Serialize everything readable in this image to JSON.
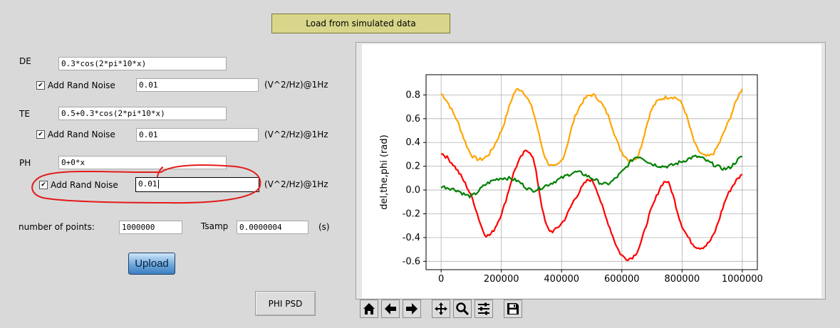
{
  "load_button": "Load from simulated data",
  "de": {
    "label": "DE",
    "expr": "0.3*cos(2*pi*10*x)",
    "noise_label": "Add Rand Noise",
    "noise_value": "0.01",
    "units": "(V^2/Hz)@1Hz",
    "checked": true
  },
  "te": {
    "label": "TE",
    "expr": "0.5+0.3*cos(2*pi*10*x)",
    "noise_label": "Add Rand Noise",
    "noise_value": "0.01",
    "units": "(V^2/Hz)@1Hz",
    "checked": true
  },
  "ph": {
    "label": "PH",
    "expr": "0+0*x",
    "noise_label": "Add Rand Noise",
    "noise_value": "0.01",
    "units": "(V^2/Hz)@1Hz",
    "checked": true
  },
  "points": {
    "label": "number of points:",
    "value": "1000000"
  },
  "tsamp": {
    "label": "Tsamp",
    "value": "0.0000004",
    "units": "(s)"
  },
  "upload_button": "Upload",
  "phi_psd_button": "PHI PSD",
  "annotation_color": "#e31b1b",
  "toolbar": {
    "icons": [
      "home-icon",
      "back-arrow-icon",
      "forward-arrow-icon",
      "pan-icon",
      "zoom-icon",
      "configure-subplots-icon",
      "save-icon"
    ]
  },
  "chart_data": {
    "type": "line",
    "ylabel": "del,the,phi (rad)",
    "xlabel": "",
    "xlim": [
      -50000,
      1050000
    ],
    "ylim": [
      -0.67,
      0.97
    ],
    "x_ticks": [
      "0",
      "200000",
      "400000",
      "600000",
      "800000",
      "1000000"
    ],
    "y_ticks": [
      "0.8",
      "0.6",
      "0.4",
      "0.2",
      "0.0",
      "-0.2",
      "-0.4",
      "-0.6"
    ],
    "grid": true,
    "x": [
      0,
      50000,
      100000,
      150000,
      200000,
      250000,
      300000,
      350000,
      400000,
      450000,
      500000,
      550000,
      600000,
      650000,
      700000,
      750000,
      800000,
      850000,
      900000,
      950000,
      1000000
    ],
    "series": [
      {
        "color": "#ffa500",
        "values": [
          0.81,
          0.6,
          0.3,
          0.28,
          0.5,
          0.84,
          0.7,
          0.25,
          0.25,
          0.65,
          0.8,
          0.65,
          0.32,
          0.28,
          0.68,
          0.78,
          0.72,
          0.35,
          0.3,
          0.55,
          0.85
        ]
      },
      {
        "color": "#ff0000",
        "values": [
          0.31,
          0.18,
          -0.05,
          -0.38,
          -0.2,
          0.2,
          0.3,
          -0.3,
          -0.28,
          -0.05,
          0.08,
          -0.25,
          -0.55,
          -0.52,
          -0.15,
          0.07,
          -0.3,
          -0.48,
          -0.4,
          -0.05,
          0.13
        ]
      },
      {
        "color": "#008000",
        "values": [
          0.03,
          0.0,
          -0.05,
          0.05,
          0.1,
          0.08,
          0.0,
          0.04,
          0.1,
          0.15,
          0.1,
          0.05,
          0.15,
          0.28,
          0.22,
          0.2,
          0.24,
          0.28,
          0.22,
          0.18,
          0.28
        ]
      }
    ]
  }
}
